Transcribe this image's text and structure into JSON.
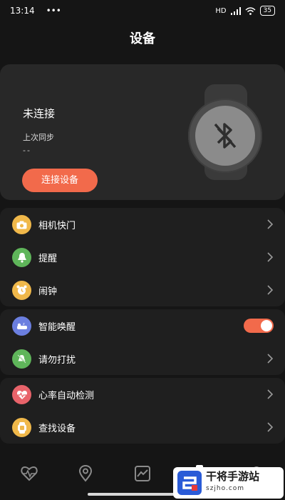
{
  "status_bar": {
    "time": "13:14",
    "dots": "•••",
    "network": "HD",
    "battery": "35"
  },
  "header": {
    "title": "设备"
  },
  "device": {
    "status": "未连接",
    "last_sync_label": "上次同步",
    "last_sync_value": "--",
    "connect_label": "连接设备"
  },
  "groups": [
    {
      "items": [
        {
          "label": "相机快门",
          "icon": "camera-icon",
          "color": "#f0b84a",
          "control": "chevron"
        },
        {
          "label": "提醒",
          "icon": "bell-icon",
          "color": "#5fb55a",
          "control": "chevron"
        },
        {
          "label": "闹钟",
          "icon": "alarm-clock-icon",
          "color": "#f0b84a",
          "control": "chevron"
        }
      ]
    },
    {
      "items": [
        {
          "label": "智能唤醒",
          "icon": "sleep-icon",
          "color": "#6b7fe0",
          "control": "toggle",
          "toggle_on": true
        },
        {
          "label": "请勿打扰",
          "icon": "do-not-disturb-icon",
          "color": "#5fb55a",
          "control": "chevron"
        }
      ]
    },
    {
      "items": [
        {
          "label": "心率自动检测",
          "icon": "heart-rate-icon",
          "color": "#e8636a",
          "control": "chevron"
        },
        {
          "label": "查找设备",
          "icon": "find-device-icon",
          "color": "#f0b84a",
          "control": "chevron"
        }
      ]
    }
  ],
  "tabs": [
    {
      "icon": "heart-pulse-icon",
      "active": false
    },
    {
      "icon": "location-icon",
      "active": false
    },
    {
      "icon": "chart-icon",
      "active": false
    },
    {
      "icon": "watch-icon",
      "active": true
    },
    {
      "icon": "profile-icon",
      "active": false
    }
  ],
  "watermark": {
    "text": "干将手游站",
    "url": "szjho.com"
  },
  "colors": {
    "accent": "#f26a4b",
    "background": "#151515",
    "card": "#282828",
    "group": "#1f1f1f"
  }
}
